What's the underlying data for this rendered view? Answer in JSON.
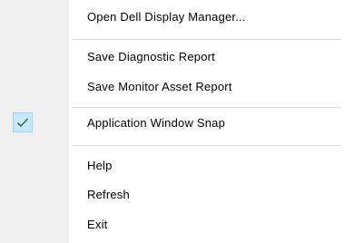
{
  "menu": {
    "items": [
      {
        "label": "Open Dell Display Manager..."
      },
      {
        "label": "Save Diagnostic Report"
      },
      {
        "label": "Save Monitor Asset Report"
      },
      {
        "label": "Application Window Snap",
        "checked": true
      },
      {
        "label": "Help"
      },
      {
        "label": "Refresh"
      },
      {
        "label": "Exit"
      }
    ]
  },
  "colors": {
    "gutter": "#f0f0f0",
    "menu_background": "#ffffff",
    "separator": "#d7d7d7",
    "check_background": "#cce8ff",
    "check_border": "#99d1ff",
    "check_mark": "#2a7a2a"
  },
  "icons": {
    "check": "check-icon"
  }
}
